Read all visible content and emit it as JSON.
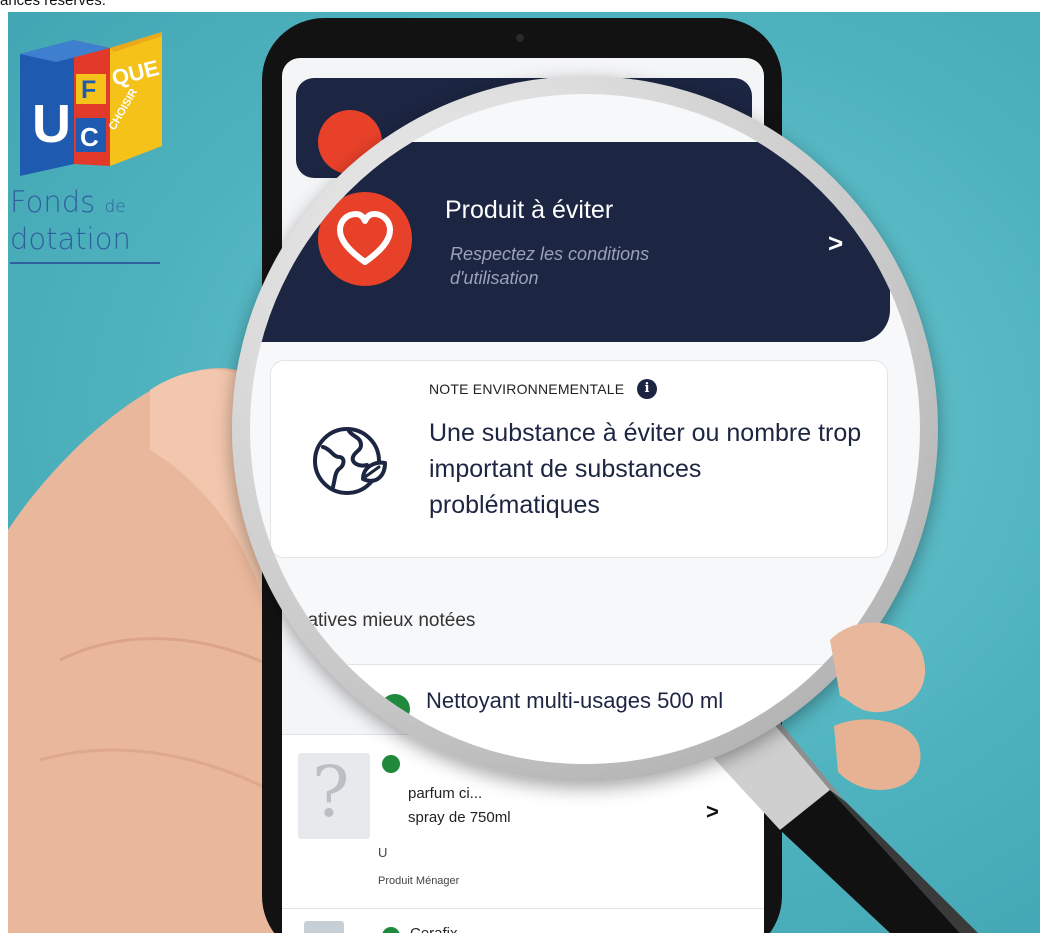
{
  "caption": {
    "partial": "ances réservés."
  },
  "logo": {
    "box_letters": {
      "u": "U",
      "f": "F",
      "c": "C",
      "que": "QUE",
      "choisir": "CHOISIR"
    },
    "line1": "Fonds",
    "line1_suffix": "de",
    "line2": "dotation"
  },
  "lens": {
    "verdict": {
      "title": "Produit à éviter",
      "subtitle": "Respectez les conditions d'utilisation",
      "chevron": ">"
    },
    "environment": {
      "label": "NOTE ENVIRONNEMENTALE",
      "info": "i",
      "text": "Une substance à éviter ou nombre trop important de substances problématiques"
    },
    "alternatives_heading": "ernatives mieux notées",
    "first_alternative": "Nettoyant multi-usages 500 ml"
  },
  "phone": {
    "second_alternative": {
      "name_line1": "parfum ci...",
      "name_line2": "spray de 750ml",
      "brand": "U",
      "category": "Produit Ménager",
      "chevron": ">"
    },
    "third_alternative": {
      "name": "Cerafix"
    }
  },
  "colors": {
    "background_teal": "#4fb3bf",
    "card_navy": "#1c2541",
    "heart_red": "#e8412a",
    "score_green": "#1f8a3c",
    "logo_blue": "#2f5f9e"
  },
  "icons": [
    "heart-icon",
    "globe-leaf-icon",
    "info-icon",
    "chevron-right-icon",
    "question-mark-icon",
    "magnifying-glass"
  ]
}
